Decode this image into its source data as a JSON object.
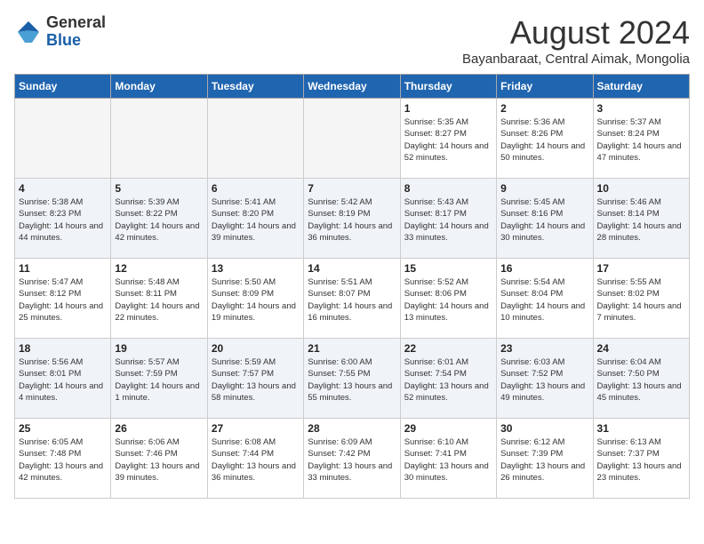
{
  "header": {
    "logo_general": "General",
    "logo_blue": "Blue",
    "month_title": "August 2024",
    "subtitle": "Bayanbaraat, Central Aimak, Mongolia"
  },
  "calendar": {
    "days_of_week": [
      "Sunday",
      "Monday",
      "Tuesday",
      "Wednesday",
      "Thursday",
      "Friday",
      "Saturday"
    ],
    "weeks": [
      {
        "days": [
          {
            "number": "",
            "empty": true
          },
          {
            "number": "",
            "empty": true
          },
          {
            "number": "",
            "empty": true
          },
          {
            "number": "",
            "empty": true
          },
          {
            "number": "1",
            "sunrise": "5:35 AM",
            "sunset": "8:27 PM",
            "daylight": "14 hours and 52 minutes."
          },
          {
            "number": "2",
            "sunrise": "5:36 AM",
            "sunset": "8:26 PM",
            "daylight": "14 hours and 50 minutes."
          },
          {
            "number": "3",
            "sunrise": "5:37 AM",
            "sunset": "8:24 PM",
            "daylight": "14 hours and 47 minutes."
          }
        ]
      },
      {
        "days": [
          {
            "number": "4",
            "sunrise": "5:38 AM",
            "sunset": "8:23 PM",
            "daylight": "14 hours and 44 minutes."
          },
          {
            "number": "5",
            "sunrise": "5:39 AM",
            "sunset": "8:22 PM",
            "daylight": "14 hours and 42 minutes."
          },
          {
            "number": "6",
            "sunrise": "5:41 AM",
            "sunset": "8:20 PM",
            "daylight": "14 hours and 39 minutes."
          },
          {
            "number": "7",
            "sunrise": "5:42 AM",
            "sunset": "8:19 PM",
            "daylight": "14 hours and 36 minutes."
          },
          {
            "number": "8",
            "sunrise": "5:43 AM",
            "sunset": "8:17 PM",
            "daylight": "14 hours and 33 minutes."
          },
          {
            "number": "9",
            "sunrise": "5:45 AM",
            "sunset": "8:16 PM",
            "daylight": "14 hours and 30 minutes."
          },
          {
            "number": "10",
            "sunrise": "5:46 AM",
            "sunset": "8:14 PM",
            "daylight": "14 hours and 28 minutes."
          }
        ]
      },
      {
        "days": [
          {
            "number": "11",
            "sunrise": "5:47 AM",
            "sunset": "8:12 PM",
            "daylight": "14 hours and 25 minutes."
          },
          {
            "number": "12",
            "sunrise": "5:48 AM",
            "sunset": "8:11 PM",
            "daylight": "14 hours and 22 minutes."
          },
          {
            "number": "13",
            "sunrise": "5:50 AM",
            "sunset": "8:09 PM",
            "daylight": "14 hours and 19 minutes."
          },
          {
            "number": "14",
            "sunrise": "5:51 AM",
            "sunset": "8:07 PM",
            "daylight": "14 hours and 16 minutes."
          },
          {
            "number": "15",
            "sunrise": "5:52 AM",
            "sunset": "8:06 PM",
            "daylight": "14 hours and 13 minutes."
          },
          {
            "number": "16",
            "sunrise": "5:54 AM",
            "sunset": "8:04 PM",
            "daylight": "14 hours and 10 minutes."
          },
          {
            "number": "17",
            "sunrise": "5:55 AM",
            "sunset": "8:02 PM",
            "daylight": "14 hours and 7 minutes."
          }
        ]
      },
      {
        "days": [
          {
            "number": "18",
            "sunrise": "5:56 AM",
            "sunset": "8:01 PM",
            "daylight": "14 hours and 4 minutes."
          },
          {
            "number": "19",
            "sunrise": "5:57 AM",
            "sunset": "7:59 PM",
            "daylight": "14 hours and 1 minute."
          },
          {
            "number": "20",
            "sunrise": "5:59 AM",
            "sunset": "7:57 PM",
            "daylight": "13 hours and 58 minutes."
          },
          {
            "number": "21",
            "sunrise": "6:00 AM",
            "sunset": "7:55 PM",
            "daylight": "13 hours and 55 minutes."
          },
          {
            "number": "22",
            "sunrise": "6:01 AM",
            "sunset": "7:54 PM",
            "daylight": "13 hours and 52 minutes."
          },
          {
            "number": "23",
            "sunrise": "6:03 AM",
            "sunset": "7:52 PM",
            "daylight": "13 hours and 49 minutes."
          },
          {
            "number": "24",
            "sunrise": "6:04 AM",
            "sunset": "7:50 PM",
            "daylight": "13 hours and 45 minutes."
          }
        ]
      },
      {
        "days": [
          {
            "number": "25",
            "sunrise": "6:05 AM",
            "sunset": "7:48 PM",
            "daylight": "13 hours and 42 minutes."
          },
          {
            "number": "26",
            "sunrise": "6:06 AM",
            "sunset": "7:46 PM",
            "daylight": "13 hours and 39 minutes."
          },
          {
            "number": "27",
            "sunrise": "6:08 AM",
            "sunset": "7:44 PM",
            "daylight": "13 hours and 36 minutes."
          },
          {
            "number": "28",
            "sunrise": "6:09 AM",
            "sunset": "7:42 PM",
            "daylight": "13 hours and 33 minutes."
          },
          {
            "number": "29",
            "sunrise": "6:10 AM",
            "sunset": "7:41 PM",
            "daylight": "13 hours and 30 minutes."
          },
          {
            "number": "30",
            "sunrise": "6:12 AM",
            "sunset": "7:39 PM",
            "daylight": "13 hours and 26 minutes."
          },
          {
            "number": "31",
            "sunrise": "6:13 AM",
            "sunset": "7:37 PM",
            "daylight": "13 hours and 23 minutes."
          }
        ]
      }
    ]
  }
}
